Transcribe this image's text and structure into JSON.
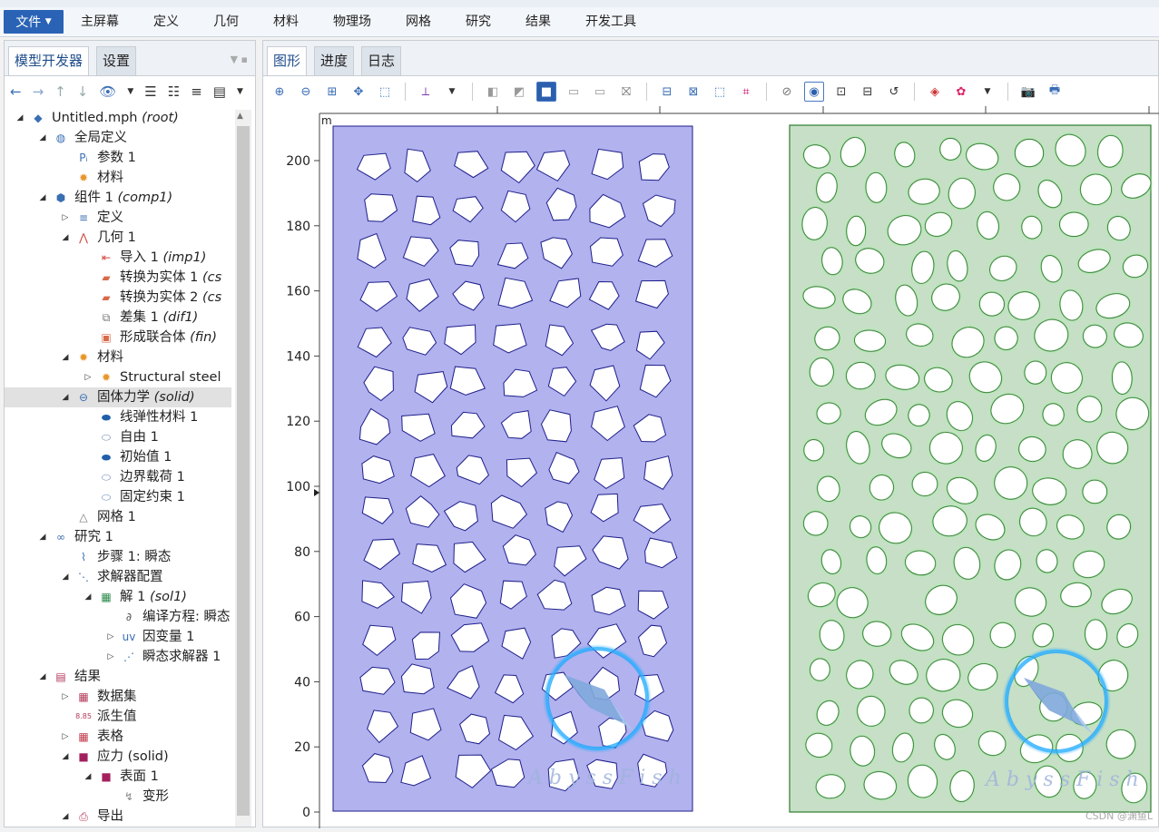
{
  "menubar": {
    "file_label": "文件",
    "items": [
      "主屏幕",
      "定义",
      "几何",
      "材料",
      "物理场",
      "网格",
      "研究",
      "结果",
      "开发工具"
    ]
  },
  "left_panel": {
    "tabs": [
      "模型开发器",
      "设置"
    ],
    "tree": [
      {
        "label": "Untitled.mph",
        "tag": "(root)",
        "icon": "model-icon",
        "depth": 0,
        "tw": "◢"
      },
      {
        "label": "全局定义",
        "tag": "",
        "icon": "globe-icon",
        "depth": 1,
        "tw": "◢"
      },
      {
        "label": "参数 1",
        "tag": "",
        "icon": "parameters-icon",
        "depth": 2,
        "tw": ""
      },
      {
        "label": "材料",
        "tag": "",
        "icon": "materials-icon",
        "depth": 2,
        "tw": ""
      },
      {
        "label": "组件 1",
        "tag": "(comp1)",
        "icon": "component-icon",
        "depth": 1,
        "tw": "◢"
      },
      {
        "label": "定义",
        "tag": "",
        "icon": "definitions-icon",
        "depth": 2,
        "tw": "▷"
      },
      {
        "label": "几何 1",
        "tag": "",
        "icon": "geometry-icon",
        "depth": 2,
        "tw": "◢"
      },
      {
        "label": "导入 1",
        "tag": "(imp1)",
        "icon": "import-icon",
        "depth": 3,
        "tw": ""
      },
      {
        "label": "转换为实体 1",
        "tag": "(cs",
        "icon": "convert-solid-icon",
        "depth": 3,
        "tw": ""
      },
      {
        "label": "转换为实体 2",
        "tag": "(cs",
        "icon": "convert-solid-icon",
        "depth": 3,
        "tw": ""
      },
      {
        "label": "差集 1",
        "tag": "(dif1)",
        "icon": "difference-icon",
        "depth": 3,
        "tw": ""
      },
      {
        "label": "形成联合体",
        "tag": "(fin)",
        "icon": "form-union-icon",
        "depth": 3,
        "tw": ""
      },
      {
        "label": "材料",
        "tag": "",
        "icon": "materials-icon",
        "depth": 2,
        "tw": "◢"
      },
      {
        "label": "Structural steel",
        "tag": "",
        "icon": "material-icon",
        "depth": 3,
        "tw": "▷"
      },
      {
        "label": "固体力学",
        "tag": "(solid)",
        "icon": "solid-mechanics-icon",
        "depth": 2,
        "tw": "◢",
        "selected": true
      },
      {
        "label": "线弹性材料 1",
        "tag": "",
        "icon": "linear-elastic-icon",
        "depth": 3,
        "tw": ""
      },
      {
        "label": "自由 1",
        "tag": "",
        "icon": "free-icon",
        "depth": 3,
        "tw": ""
      },
      {
        "label": "初始值 1",
        "tag": "",
        "icon": "initial-values-icon",
        "depth": 3,
        "tw": ""
      },
      {
        "label": "边界载荷 1",
        "tag": "",
        "icon": "boundary-load-icon",
        "depth": 3,
        "tw": ""
      },
      {
        "label": "固定约束 1",
        "tag": "",
        "icon": "fixed-constraint-icon",
        "depth": 3,
        "tw": ""
      },
      {
        "label": "网格 1",
        "tag": "",
        "icon": "mesh-icon",
        "depth": 2,
        "tw": ""
      },
      {
        "label": "研究 1",
        "tag": "",
        "icon": "study-icon",
        "depth": 1,
        "tw": "◢"
      },
      {
        "label": "步骤 1: 瞬态",
        "tag": "",
        "icon": "time-dependent-icon",
        "depth": 2,
        "tw": ""
      },
      {
        "label": "求解器配置",
        "tag": "",
        "icon": "solver-config-icon",
        "depth": 2,
        "tw": "◢"
      },
      {
        "label": "解 1",
        "tag": "(sol1)",
        "icon": "solution-icon",
        "depth": 3,
        "tw": "◢"
      },
      {
        "label": "编译方程: 瞬态",
        "tag": "",
        "icon": "compile-equations-icon",
        "depth": 4,
        "tw": ""
      },
      {
        "label": "因变量 1",
        "tag": "",
        "icon": "dependent-variables-icon",
        "depth": 4,
        "tw": "▷"
      },
      {
        "label": "瞬态求解器 1",
        "tag": "",
        "icon": "time-solver-icon",
        "depth": 4,
        "tw": "▷"
      },
      {
        "label": "结果",
        "tag": "",
        "icon": "results-icon",
        "depth": 1,
        "tw": "◢"
      },
      {
        "label": "数据集",
        "tag": "",
        "icon": "datasets-icon",
        "depth": 2,
        "tw": "▷"
      },
      {
        "label": "派生值",
        "tag": "",
        "icon": "derived-values-icon",
        "depth": 2,
        "tw": ""
      },
      {
        "label": "表格",
        "tag": "",
        "icon": "tables-icon",
        "depth": 2,
        "tw": "▷"
      },
      {
        "label": "应力 (solid)",
        "tag": "",
        "icon": "plot-group-icon",
        "depth": 2,
        "tw": "◢"
      },
      {
        "label": "表面 1",
        "tag": "",
        "icon": "surface-icon",
        "depth": 3,
        "tw": "◢"
      },
      {
        "label": "变形",
        "tag": "",
        "icon": "deformation-icon",
        "depth": 4,
        "tw": ""
      },
      {
        "label": "导出",
        "tag": "",
        "icon": "export-icon",
        "depth": 2,
        "tw": "◢"
      }
    ]
  },
  "right_panel": {
    "tabs": [
      "图形",
      "进度",
      "日志"
    ],
    "axis_unit": "m",
    "y_ticks": [
      "0",
      "20",
      "40",
      "60",
      "80",
      "100",
      "120",
      "140",
      "160",
      "180",
      "200"
    ]
  },
  "watermark": "AbyssFish",
  "credit": "CSDN @渊鱼L",
  "colors": {
    "menu_accent": "#2a63b6",
    "lattice_fill": "#b1b2ee",
    "lattice_stroke": "#1e1e8a",
    "porous_fill": "#c7dfc7",
    "porous_stroke": "#2e7d2e",
    "porous_glow": "#a8f0a8"
  }
}
